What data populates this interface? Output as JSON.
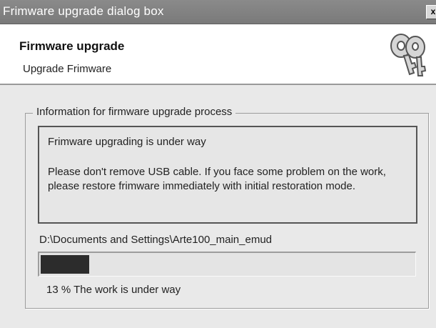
{
  "window": {
    "title": "Frimware upgrade dialog box",
    "close_glyph": "x"
  },
  "header": {
    "title": "Firmware upgrade",
    "subtitle": "Upgrade Frimware",
    "icon": "keys-icon"
  },
  "group": {
    "legend": "Information for firmware upgrade process"
  },
  "info": {
    "line1": "Frimware upgrading is under way",
    "line2": "Please don't remove USB cable. If you face some problem on the work, please restore frimware immediately with initial restoration mode."
  },
  "progress": {
    "path": "D:\\Documents and Settings\\Arte100_main_emud",
    "percent": 13,
    "status": "13 %  The work is under way"
  },
  "colors": {
    "titlebar": "#7f7f7f",
    "progress_fill": "#2c2c2c"
  }
}
